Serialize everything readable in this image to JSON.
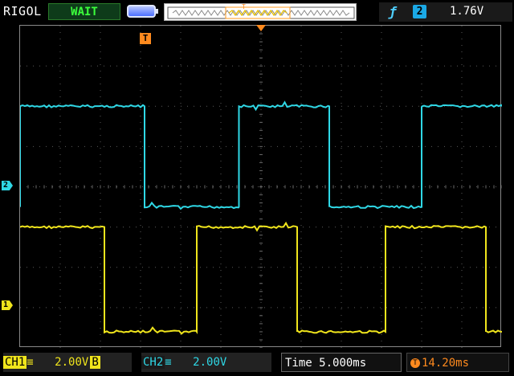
{
  "header": {
    "brand": "RIGOL",
    "run_status": "WAIT",
    "trigger": {
      "edge_icon": "rising-edge-icon",
      "source": "2",
      "level": "1.76V"
    }
  },
  "channels": {
    "ch1": {
      "label": "CH1",
      "scale": "2.00V",
      "coupling_icon": "dc-coupling-icon",
      "bw_flag": "B",
      "marker": "1",
      "color": "#f0e51c"
    },
    "ch2": {
      "label": "CH2",
      "scale": "2.00V",
      "coupling_icon": "dc-coupling-icon",
      "marker": "2",
      "color": "#2fd8e6"
    }
  },
  "timebase": {
    "label": "Time",
    "value": "5.000ms"
  },
  "trigger_position": {
    "value": "14.20ms"
  },
  "markers": {
    "trigger_marker": "T"
  },
  "waveforms": {
    "ch2_square": {
      "high_level_div": 2.5,
      "low_level_div": 0,
      "edges_div": [
        0,
        3.1,
        5.45,
        7.7,
        10.0
      ]
    },
    "ch1_square": {
      "high_level_div": 1.5,
      "low_level_div": -1.0,
      "edges_div": [
        2.1,
        4.4,
        6.9,
        9.1,
        11.6
      ]
    }
  }
}
